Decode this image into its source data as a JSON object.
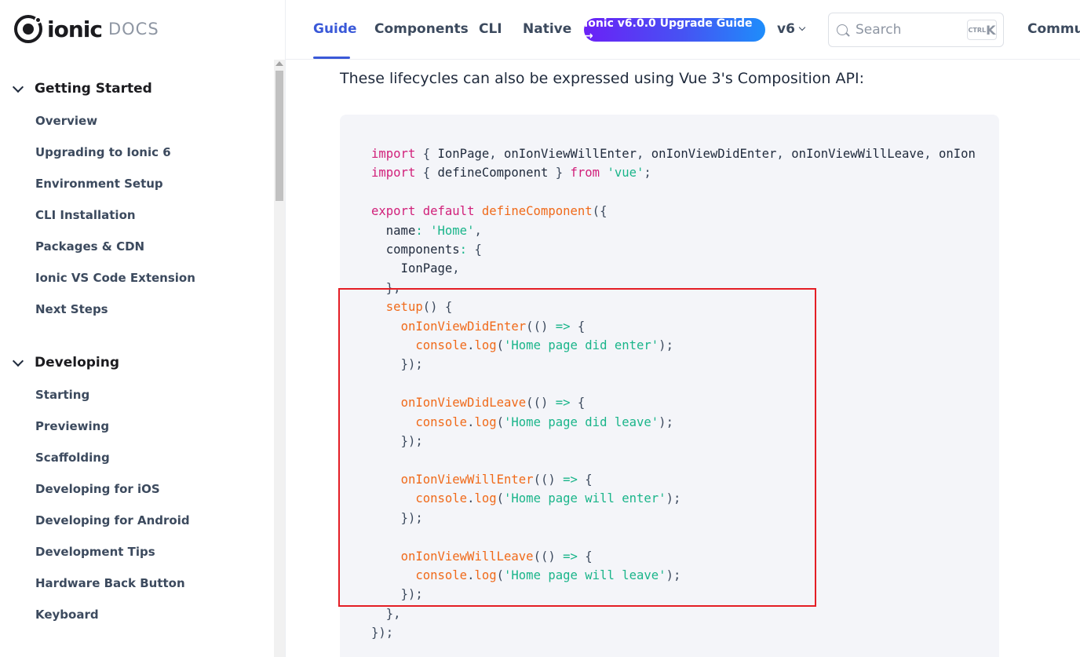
{
  "brand": {
    "word": "ionic",
    "docs": "DOCS"
  },
  "topnav": {
    "tabs": [
      {
        "label": "Guide"
      },
      {
        "label": "Components"
      },
      {
        "label": "CLI"
      },
      {
        "label": "Native"
      }
    ],
    "active_tab": "Guide",
    "upgrade_button": "Ionic v6.0.0 Upgrade Guide →",
    "version": "v6",
    "search": {
      "placeholder": "Search",
      "shortcut_ctrl": "CTRL",
      "shortcut_key": "K"
    },
    "community": "Community"
  },
  "sidebar": {
    "sections": [
      {
        "title": "Getting Started",
        "items": [
          "Overview",
          "Upgrading to Ionic 6",
          "Environment Setup",
          "CLI Installation",
          "Packages & CDN",
          "Ionic VS Code Extension",
          "Next Steps"
        ]
      },
      {
        "title": "Developing",
        "items": [
          "Starting",
          "Previewing",
          "Scaffolding",
          "Developing for iOS",
          "Developing for Android",
          "Development Tips",
          "Hardware Back Button",
          "Keyboard"
        ]
      }
    ]
  },
  "main": {
    "intro": "These lifecycles can also be expressed using Vue 3's Composition API:",
    "code_lines": [
      "import { IonPage, onIonViewWillEnter, onIonViewDidEnter, onIonViewWillLeave, onIon",
      "import { defineComponent } from 'vue';",
      "",
      "export default defineComponent({",
      "  name: 'Home',",
      "  components: {",
      "    IonPage,",
      "  },",
      "  setup() {",
      "    onIonViewDidEnter(() => {",
      "      console.log('Home page did enter');",
      "    });",
      "",
      "    onIonViewDidLeave(() => {",
      "      console.log('Home page did leave');",
      "    });",
      "",
      "    onIonViewWillEnter(() => {",
      "      console.log('Home page will enter');",
      "    });",
      "",
      "    onIonViewWillLeave(() => {",
      "      console.log('Home page will leave');",
      "    });",
      "  },",
      "});"
    ]
  },
  "colors": {
    "accent": "#3a59d8",
    "keyword": "#d1207a",
    "function": "#f06a1a",
    "string": "#1ab58a",
    "highlight_border": "#e41e25"
  }
}
